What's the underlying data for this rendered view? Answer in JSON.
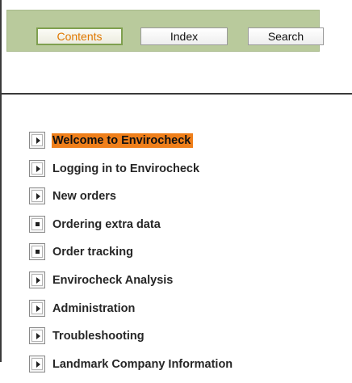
{
  "tabs": {
    "contents": "Contents",
    "index": "Index",
    "search": "Search"
  },
  "toc": {
    "items": [
      {
        "label": "Welcome to Envirocheck",
        "icon": "page-arrow-icon",
        "selected": true
      },
      {
        "label": "Logging in to Envirocheck",
        "icon": "page-arrow-icon"
      },
      {
        "label": "New orders",
        "icon": "page-arrow-icon"
      },
      {
        "label": "Ordering extra data",
        "icon": "page-bullet-icon"
      },
      {
        "label": "Order tracking",
        "icon": "page-bullet-icon"
      },
      {
        "label": "Envirocheck Analysis",
        "icon": "page-arrow-icon"
      },
      {
        "label": "Administration",
        "icon": "page-arrow-icon"
      },
      {
        "label": "Troubleshooting",
        "icon": "page-arrow-icon"
      },
      {
        "label": "Landmark Company Information",
        "icon": "page-arrow-icon"
      }
    ]
  },
  "colors": {
    "tab_bar_bg": "#b9ca9c",
    "active_tab_text": "#e07800",
    "selected_highlight": "#ef7f1a"
  }
}
